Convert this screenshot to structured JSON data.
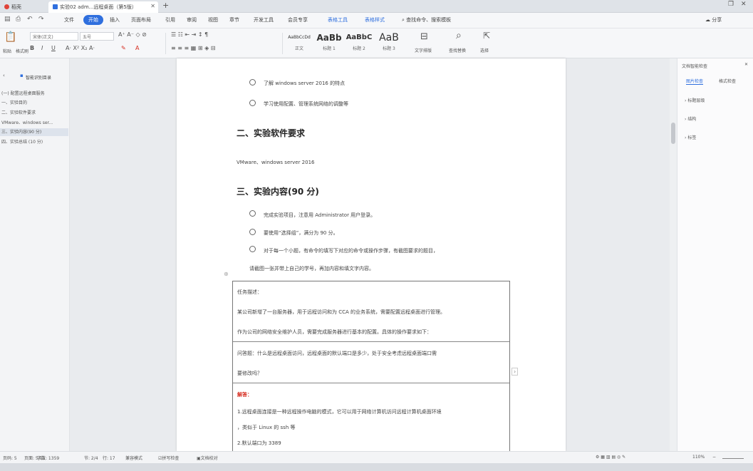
{
  "tabs": {
    "home": "稻壳",
    "doc": "实验02 adm...远程桌面（第5版）"
  },
  "menu": {
    "items": [
      "文件",
      "开始",
      "插入",
      "页面布局",
      "引用",
      "审阅",
      "视图",
      "章节",
      "开发工具",
      "会员专享",
      "表格工具",
      "表格样式"
    ],
    "active": "开始",
    "search": "查找命令、搜索模板",
    "share": "分享"
  },
  "ribbon": {
    "paste": "粘贴",
    "format_painter": "格式刷",
    "font_family": "宋体(正文)",
    "font_size": "五号",
    "styles": [
      {
        "sample": "AaBbCcDd",
        "name": "正文"
      },
      {
        "sample": "AaBb",
        "name": "标题 1"
      },
      {
        "sample": "AaBbC",
        "name": "标题 2"
      },
      {
        "sample": "AaB",
        "name": "标题 3"
      }
    ],
    "text_tools": "文字排版",
    "find_replace": "查找替换",
    "select": "选择"
  },
  "nav": {
    "title": "智能识别目录",
    "items": [
      "(一) 配置远程桌面服务",
      "一、实验目的",
      "二、实验软件要求",
      "VMware、windows ser...",
      "三、实验内容(90 分)",
      "四、实验总结 (10 分)"
    ],
    "selected_index": 4
  },
  "doc": {
    "bullet1": "了解 windows server 2016 的特点",
    "bullet2": "学习使用配置、管理系统网络的调整等",
    "h2_software": "二、实验软件要求",
    "software": "VMware、windows server 2016",
    "h2_content": "三、实验内容(90 分)",
    "c1": "完成实验项目，注意用 Administrator 用户登录。",
    "c2": "要使用“选择组”，满分为 90 分。",
    "c3": "对于每一个小题，有命令的填写下对应的命令或操作步骤，有截图要求的题目，",
    "c3b": "请截图一张并带上自己的学号，再加内容和填文字内容。",
    "table": {
      "r1_title": "任务描述：",
      "r1_l1": "某公司新增了一台服务器，用于远程访问和为 CCA 的业务系统，需要配置远程桌面进行管理。",
      "r1_l2": "作为公司的网络安全维护人员，需要完成服务器进行基本的配置。具体的操作要求如下：",
      "r2_l1": "问答题：什么是远程桌面访问，远程桌面的默认端口是多少，处于安全考虑远程桌面端口需",
      "r2_l2": "要修改吗？",
      "r3_title": "解答：",
      "r3_l1": "1.远程桌面连接是一种远程操作电脑的模式，它可以用于网络计算机访问远程计算机桌面环境",
      "r3_l2": "，类似于 Linux 的 ssh 等",
      "r3_l3": "2.默认端口为 3389"
    }
  },
  "rightpane": {
    "title": "文档智能检查",
    "tab1": "图片检查",
    "tab2": "格式检查",
    "items": [
      "标题层级",
      "结构",
      "标签"
    ]
  },
  "status": {
    "page": "页码: 5",
    "pages": "页面: 5/11",
    "words": "字数: 1359",
    "section": "节: 2/4",
    "row": "行: 17",
    "spell": "拼写检查",
    "doc_check": "文档校对",
    "compat": "兼容模式",
    "zoom": "110%"
  }
}
